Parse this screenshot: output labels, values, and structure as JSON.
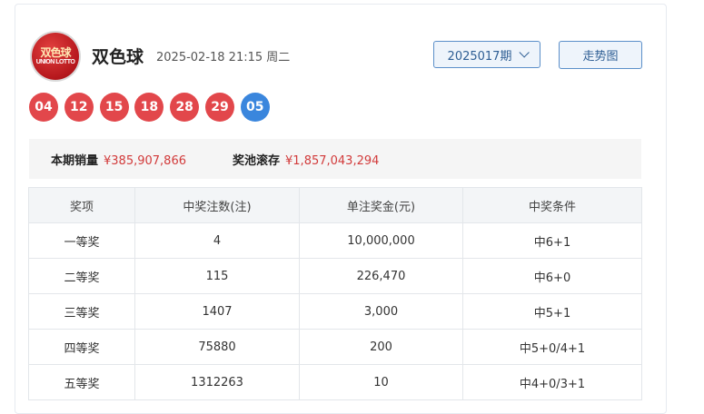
{
  "header": {
    "logo_text_line1": "双色球",
    "logo_text_line2": "UNION LOTTO",
    "title": "双色球",
    "datetime": "2025-02-18 21:15 周二",
    "issue_select": "2025017期",
    "trend_button": "走势图"
  },
  "balls": {
    "red": [
      "04",
      "12",
      "15",
      "18",
      "28",
      "29"
    ],
    "blue": [
      "05"
    ],
    "red_color": "#e2474b",
    "blue_color": "#3a86dd"
  },
  "stats": {
    "sales_label": "本期销量",
    "sales_value": "¥385,907,866",
    "pool_label": "奖池滚存",
    "pool_value": "¥1,857,043,294"
  },
  "table": {
    "headers": [
      "奖项",
      "中奖注数(注)",
      "单注奖金(元)",
      "中奖条件"
    ],
    "rows": [
      [
        "一等奖",
        "4",
        "10,000,000",
        "中6+1"
      ],
      [
        "二等奖",
        "115",
        "226,470",
        "中6+0"
      ],
      [
        "三等奖",
        "1407",
        "3,000",
        "中5+1"
      ],
      [
        "四等奖",
        "75880",
        "200",
        "中5+0/4+1"
      ],
      [
        "五等奖",
        "1312263",
        "10",
        "中4+0/3+1"
      ]
    ]
  }
}
